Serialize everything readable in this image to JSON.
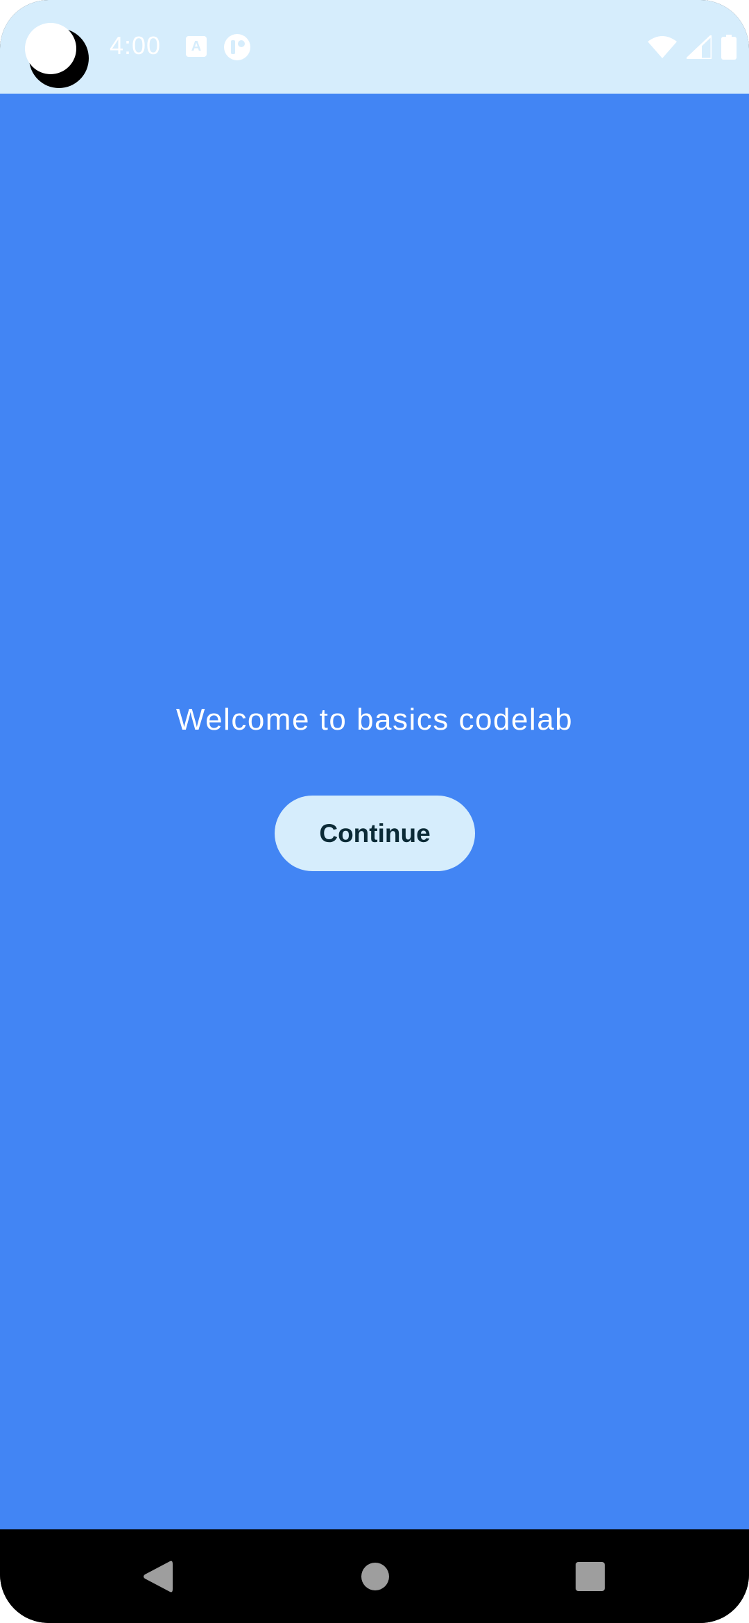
{
  "status_bar": {
    "time": "4:00",
    "notification_icons": [
      "text-recognition-icon",
      "app-notification-icon"
    ],
    "system_icons": [
      "wifi-icon",
      "cellular-signal-icon",
      "battery-icon"
    ],
    "background_color": "#d6edfc"
  },
  "screen": {
    "background_color": "#4285f4",
    "welcome_text": "Welcome to basics codelab",
    "continue_label": "Continue",
    "button_color": "#d6edfc"
  },
  "navigation_bar": {
    "buttons": [
      "back",
      "home",
      "recents"
    ]
  }
}
